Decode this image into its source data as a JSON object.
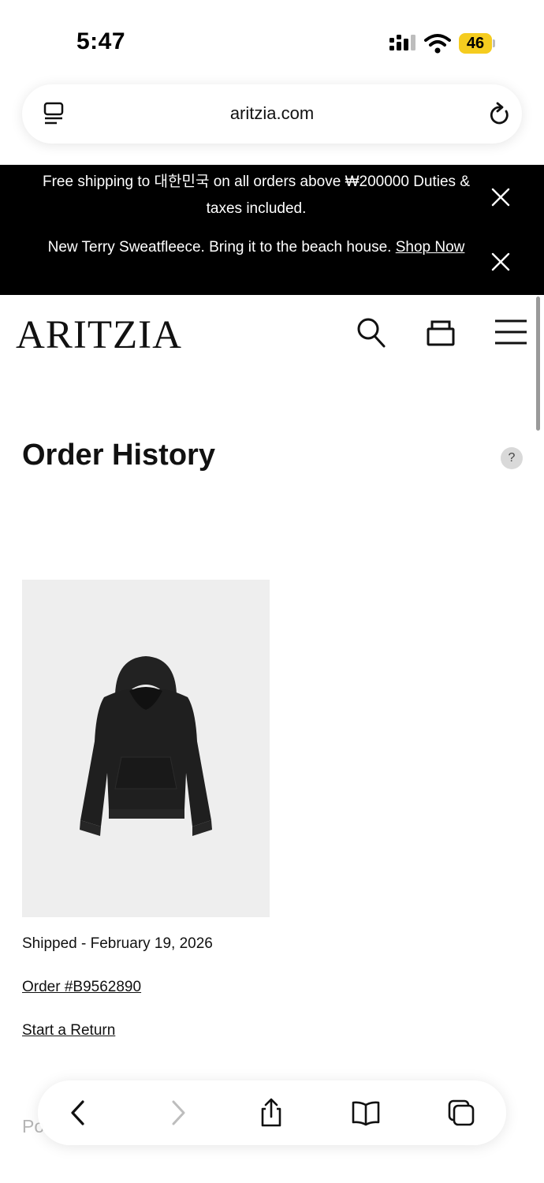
{
  "status_bar": {
    "time": "5:47",
    "battery": "46"
  },
  "browser": {
    "address": "aritzia.com"
  },
  "promo": {
    "line1": "Free shipping to 대한민국 on all orders above ₩200000 Duties & taxes included.",
    "line2_text": "New Terry Sweatfleece. Bring it to the beach house. ",
    "line2_link": "Shop Now"
  },
  "header": {
    "logo": "ARITZIA"
  },
  "page": {
    "title": "Order History",
    "help": "?"
  },
  "order": {
    "status": "Shipped - February 19, 2026",
    "order_link": "Order #B9562890",
    "return_link": "Start a Return",
    "image_alt": "black hoodie"
  },
  "partial_text": "Po",
  "colors": {
    "banner_bg": "#000000",
    "battery": "#f5cc1f",
    "image_bg": "#eeeeee"
  },
  "icons": [
    "signal-icon",
    "wifi-icon",
    "reader-icon",
    "reload-icon",
    "close-icon",
    "search-icon",
    "bag-icon",
    "menu-icon",
    "back-icon",
    "forward-icon",
    "share-icon",
    "bookmarks-icon",
    "tabs-icon"
  ]
}
